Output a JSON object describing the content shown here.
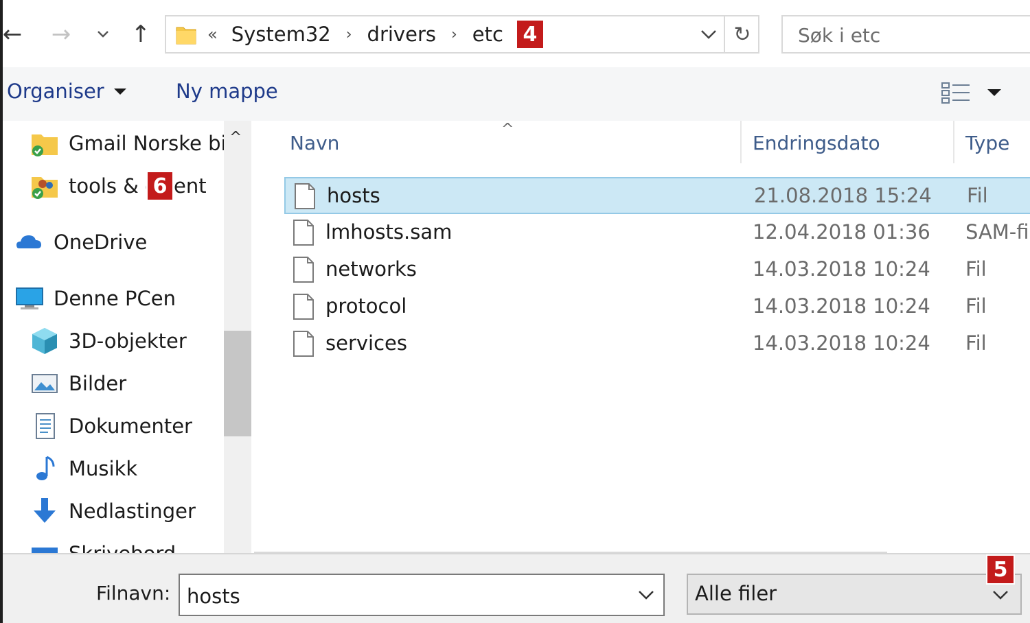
{
  "nav": {
    "back_icon": "arrow-left-icon",
    "forward_icon": "arrow-right-icon",
    "recent_icon": "chevron-down-icon",
    "up_icon": "arrow-up-icon",
    "back_glyph": "←",
    "forward_glyph": "→",
    "up_glyph": "↑"
  },
  "address": {
    "overflow": "«",
    "crumbs": [
      "System32",
      "drivers",
      "etc"
    ],
    "separator": "›",
    "refresh_glyph": "↻",
    "badge_4": "4"
  },
  "search": {
    "placeholder": "Søk i etc"
  },
  "toolbar": {
    "organize": "Organiser",
    "new_folder": "Ny mappe"
  },
  "sidebar": {
    "items": [
      {
        "label": "Gmail Norske bil",
        "icon": "shared-folder-icon"
      },
      {
        "label": "tools & c",
        "label_tail": "ent",
        "icon": "shared-users-folder-icon",
        "badge": "6"
      },
      {
        "label": "OneDrive",
        "icon": "onedrive-cloud-icon"
      },
      {
        "label": "Denne PCen",
        "icon": "computer-icon"
      },
      {
        "label": "3D-objekter",
        "icon": "3d-objects-icon"
      },
      {
        "label": "Bilder",
        "icon": "pictures-icon"
      },
      {
        "label": "Dokumenter",
        "icon": "documents-icon"
      },
      {
        "label": "Musikk",
        "icon": "music-icon"
      },
      {
        "label": "Nedlastinger",
        "icon": "downloads-icon"
      },
      {
        "label": "Skrivebord",
        "icon": "desktop-icon"
      }
    ],
    "scroll_up_glyph": "^"
  },
  "columns": {
    "name": "Navn",
    "date": "Endringsdato",
    "type": "Type",
    "sort_glyph": "^"
  },
  "files": [
    {
      "name": "hosts",
      "date": "21.08.2018 15:24",
      "type": "Fil",
      "selected": true
    },
    {
      "name": "lmhosts.sam",
      "date": "12.04.2018 01:36",
      "type": "SAM-fi",
      "selected": false
    },
    {
      "name": "networks",
      "date": "14.03.2018 10:24",
      "type": "Fil",
      "selected": false
    },
    {
      "name": "protocol",
      "date": "14.03.2018 10:24",
      "type": "Fil",
      "selected": false
    },
    {
      "name": "services",
      "date": "14.03.2018 10:24",
      "type": "Fil",
      "selected": false
    }
  ],
  "footer": {
    "filename_label": "Filnavn:",
    "filename_value": "hosts",
    "filetype": "Alle filer",
    "badge_5": "5"
  },
  "colors": {
    "selection_bg": "#cce8f5",
    "selection_border": "#94c9e6",
    "badge_red": "#c31b1b",
    "header_text": "#3e5c8a",
    "toolbar_text": "#1e3a8a"
  }
}
